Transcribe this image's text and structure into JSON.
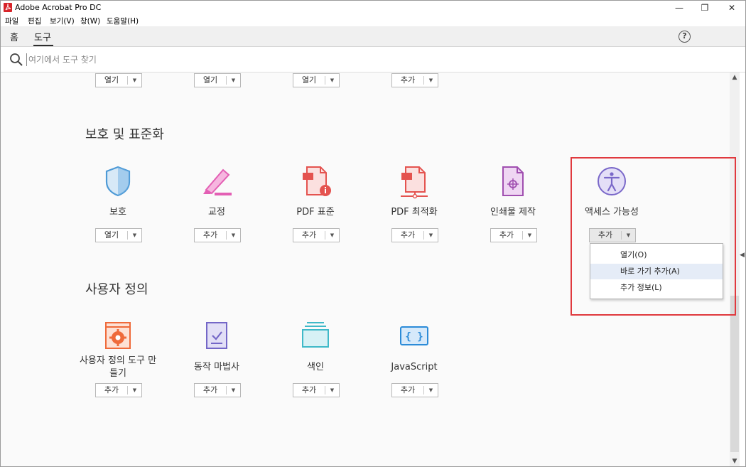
{
  "window": {
    "title": "Adobe Acrobat Pro DC"
  },
  "menubar": [
    "파일",
    "편집",
    "보기(V)",
    "창(W)",
    "도움말(H)"
  ],
  "topnav": {
    "home": "홈",
    "tools": "도구",
    "help_glyph": "?"
  },
  "search": {
    "placeholder": "여기에서 도구 찾기"
  },
  "top_row_buttons": [
    "열기",
    "열기",
    "열기",
    "추가"
  ],
  "sections": [
    {
      "title": "보호 및 표준화",
      "tools": [
        {
          "name": "보호",
          "button": "열기",
          "icon": "shield-icon"
        },
        {
          "name": "교정",
          "button": "추가",
          "icon": "highlighter-icon"
        },
        {
          "name": "PDF 표준",
          "button": "추가",
          "icon": "pdf-standard-icon"
        },
        {
          "name": "PDF 최적화",
          "button": "추가",
          "icon": "pdf-optimize-icon"
        },
        {
          "name": "인쇄물 제작",
          "button": "추가",
          "icon": "print-production-icon"
        },
        {
          "name": "액세스 가능성",
          "button": "추가",
          "icon": "accessibility-icon"
        }
      ]
    },
    {
      "title": "사용자 정의",
      "tools": [
        {
          "name_line1": "사용자 정의 도구 만",
          "name_line2": "들기",
          "button": "추가",
          "icon": "custom-tool-icon"
        },
        {
          "name": "동작 마법사",
          "button": "추가",
          "icon": "action-wizard-icon"
        },
        {
          "name": "색인",
          "button": "추가",
          "icon": "index-icon"
        },
        {
          "name": "JavaScript",
          "button": "추가",
          "icon": "javascript-icon"
        }
      ]
    }
  ],
  "dropdown": {
    "items": [
      "열기(O)",
      "바로 가기 추가(A)",
      "추가 정보(L)"
    ],
    "hovered_index": 1
  },
  "colors": {
    "highlight": "#e0393e",
    "shield": "#5aa0d8",
    "highlighter": "#e35fb4",
    "pdf_red": "#e4534f",
    "print": "#a04fb0",
    "accessibility": "#7a68c9",
    "custom": "#ef6a3a",
    "action": "#7467c7",
    "index": "#3fb9c8",
    "javascript": "#2b8bd8"
  }
}
